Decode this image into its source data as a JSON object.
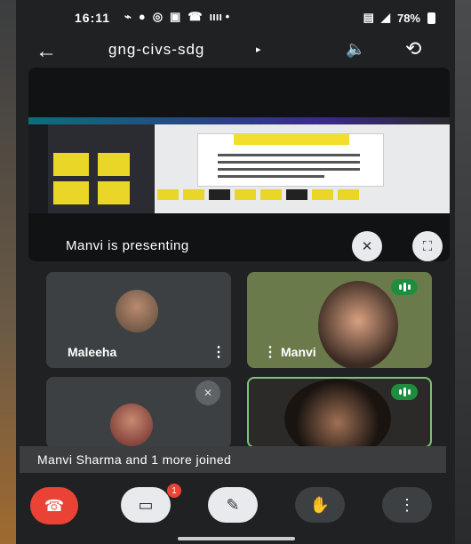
{
  "status_bar": {
    "time": "16:11",
    "notification_icons": [
      "call-icon",
      "chat-icon",
      "whatsapp-icon",
      "u-icon",
      "phone-icon"
    ],
    "extra": "ıııı  •",
    "battery": "78%"
  },
  "header": {
    "title": "gng-civs-sdg",
    "caret": "▸"
  },
  "presentation": {
    "label": "Manvi is presenting"
  },
  "participants": [
    {
      "name": "Maleeha",
      "speaking": false
    },
    {
      "name": "Manvi",
      "speaking": true
    },
    {
      "name": "",
      "muted": true
    },
    {
      "name": "",
      "speaking": true
    }
  ],
  "toast": {
    "text": "Manvi Sharma and 1 more joined"
  },
  "controls": {
    "camera_badge": "1"
  },
  "colors": {
    "end_call": "#ea4335",
    "speaking": "#1e8e3e",
    "slide_accent": "#e9d627"
  }
}
